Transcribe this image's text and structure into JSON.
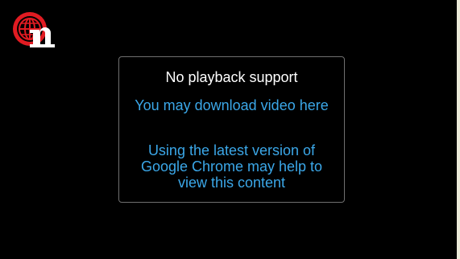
{
  "player": {
    "background": "#000000",
    "logo_icon": "globe-n-logo-icon"
  },
  "message": {
    "title": "No playback support",
    "download_link": "You may download video here",
    "chrome_link": "Using the latest version of Google Chrome may help to view this content",
    "link_color": "#3ba7e8"
  }
}
